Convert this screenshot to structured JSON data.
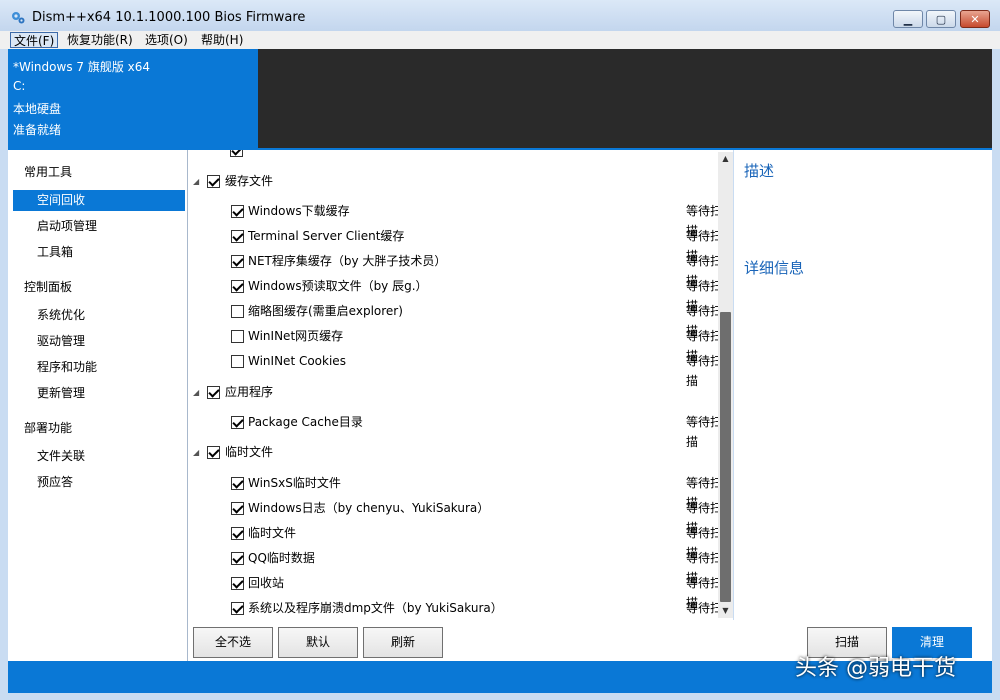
{
  "window": {
    "title": "Dism++x64 10.1.1000.100 Bios Firmware",
    "min": "▁",
    "max": "▢",
    "close": "✕"
  },
  "menu": {
    "items": [
      "文件(F)",
      "恢复功能(R)",
      "选项(O)",
      "帮助(H)"
    ]
  },
  "header": {
    "os": "*Windows 7 旗舰版 x64",
    "drive": "C:",
    "disk_type": "本地硬盘",
    "status": "准备就绪"
  },
  "sidebar": {
    "groups": [
      {
        "label": "常用工具",
        "items": [
          "空间回收",
          "启动项管理",
          "工具箱"
        ]
      },
      {
        "label": "控制面板",
        "items": [
          "系统优化",
          "驱动管理",
          "程序和功能",
          "更新管理"
        ]
      },
      {
        "label": "部署功能",
        "items": [
          "文件关联",
          "预应答"
        ]
      }
    ],
    "selected": "空间回收"
  },
  "list": {
    "categories": [
      {
        "label": "缓存文件",
        "checked": true,
        "items": [
          {
            "label": "Windows下载缓存",
            "checked": true,
            "status": "等待扫描"
          },
          {
            "label": "Terminal Server Client缓存",
            "checked": true,
            "status": "等待扫描"
          },
          {
            "label": "NET程序集缓存（by 大胖子技术员）",
            "checked": true,
            "status": "等待扫描"
          },
          {
            "label": "Windows预读取文件（by 辰g.）",
            "checked": true,
            "status": "等待扫描"
          },
          {
            "label": "缩略图缓存(需重启explorer)",
            "checked": false,
            "status": "等待扫描"
          },
          {
            "label": "WinINet网页缓存",
            "checked": false,
            "status": "等待扫描"
          },
          {
            "label": "WinINet Cookies",
            "checked": false,
            "status": "等待扫描"
          }
        ]
      },
      {
        "label": "应用程序",
        "checked": true,
        "items": [
          {
            "label": "Package Cache目录",
            "checked": true,
            "status": "等待扫描"
          }
        ]
      },
      {
        "label": "临时文件",
        "checked": true,
        "items": [
          {
            "label": "WinSxS临时文件",
            "checked": true,
            "status": "等待扫描"
          },
          {
            "label": "Windows日志（by chenyu、YukiSakura）",
            "checked": true,
            "status": "等待扫描"
          },
          {
            "label": "临时文件",
            "checked": true,
            "status": "等待扫描"
          },
          {
            "label": "QQ临时数据",
            "checked": true,
            "status": "等待扫描"
          },
          {
            "label": "回收站",
            "checked": true,
            "status": "等待扫描"
          },
          {
            "label": "系统以及程序崩溃dmp文件（by YukiSakura）",
            "checked": true,
            "status": "等待扫描"
          }
        ]
      }
    ]
  },
  "right_panel": {
    "description_title": "描述",
    "details_title": "详细信息"
  },
  "buttons": {
    "select_none": "全不选",
    "default": "默认",
    "refresh": "刷新",
    "scan": "扫描",
    "clean": "清理"
  },
  "watermark": "头条 @弱电干货",
  "colors": {
    "accent": "#0a78d6",
    "header_dark": "#2a2a2a",
    "link_blue": "#1964b8"
  }
}
